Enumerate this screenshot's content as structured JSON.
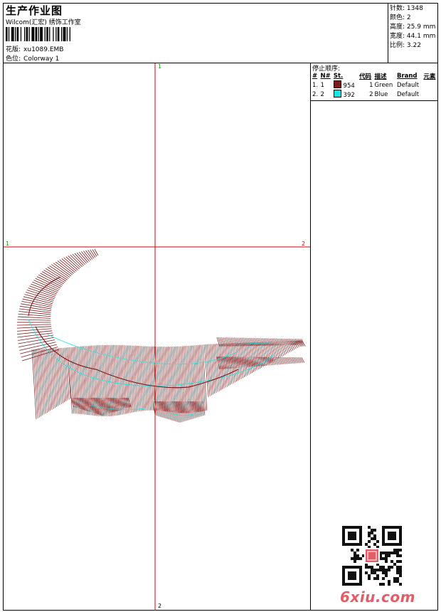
{
  "header": {
    "title": "生产作业图",
    "company": "Wilcom(汇宏) 绣饰工作室",
    "design_label": "花版:",
    "design_file": "xu1089.EMB",
    "colorway_label": "色位:",
    "colorway": "Colorway 1"
  },
  "stats": [
    {
      "label": "针数:",
      "value": "1348"
    },
    {
      "label": "颜色:",
      "value": "2"
    },
    {
      "label": "高度:",
      "value": "25.9 mm"
    },
    {
      "label": "宽度:",
      "value": "44.1 mm"
    },
    {
      "label": "比例:",
      "value": "3.22"
    }
  ],
  "stop_sequence": {
    "title": "停止顺序:",
    "columns": [
      "#",
      "N#",
      "St.",
      "代码",
      "描述",
      "Brand",
      "元素"
    ],
    "rows": [
      {
        "seq": "1.",
        "n": "1",
        "color": "#7a1a1a",
        "code": "954",
        "st": "1",
        "desc": "Green",
        "brand": "Default"
      },
      {
        "seq": "2.",
        "n": "2",
        "color": "#17e5e5",
        "code": "392",
        "st": "2",
        "desc": "Blue",
        "brand": "Default"
      }
    ]
  },
  "axes": {
    "top": "1",
    "left": "1",
    "right": "2",
    "bottom": "2",
    "line_color": "#d40000"
  },
  "design_colors": {
    "thread_primary": "#7a1a1a",
    "thread_secondary": "#17e5e5"
  },
  "watermark": {
    "text": "6xiu.com",
    "color": "#e25d65"
  }
}
